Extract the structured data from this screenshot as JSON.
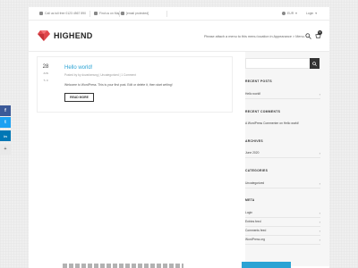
{
  "topbar": {
    "phone": "Call us toll free 0123 4567 890",
    "location": "Find us on Map",
    "email": "[email protected]",
    "currency": "EUR",
    "login": "Login"
  },
  "header": {
    "logo_text": "HIGHEND",
    "menu_note": "Please attach a menu to this menu location in Appearance > Menu.",
    "cart_count": "0"
  },
  "post": {
    "day": "28",
    "month": "JUN",
    "comments": "0",
    "title": "Hello world!",
    "meta_author": "Posted by by dovarkensng",
    "meta_category": "Uncategorized",
    "meta_comments": "1 Comment",
    "excerpt": "Welcome to WordPress. This is your first post. Edit or delete it, then start writing!",
    "read_more": "READ MORE"
  },
  "sidebar": {
    "recent_posts": {
      "heading": "RECENT POSTS",
      "items": [
        "Hello world!"
      ]
    },
    "recent_comments": {
      "heading": "RECENT COMMENTS",
      "items": [
        "A WordPress Commenter on Hello world!"
      ]
    },
    "archives": {
      "heading": "ARCHIVES",
      "items": [
        "June 2020"
      ]
    },
    "categories": {
      "heading": "CATEGORIES",
      "items": [
        "Uncategorized"
      ]
    },
    "meta": {
      "heading": "META",
      "items": [
        "Login",
        "Entries feed",
        "Comments feed",
        "WordPress.org"
      ]
    }
  },
  "share": {
    "facebook": "f",
    "twitter": "t",
    "linkedin": "in",
    "more": "+"
  },
  "colors": {
    "accent": "#2aa3d4",
    "facebook": "#3b5998",
    "twitter": "#1da1f2",
    "linkedin": "#0077b5"
  }
}
